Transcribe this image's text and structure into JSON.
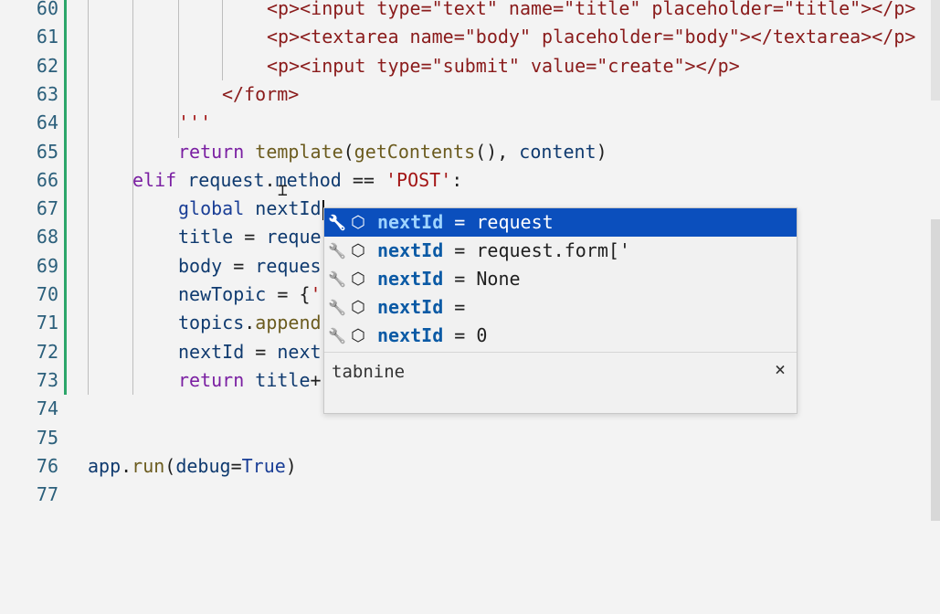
{
  "editor": {
    "lines": [
      {
        "num": "60",
        "parts": [
          [
            "tag",
            "<p><input type=\"text\" name=\"title\" placeholder=\"title\"></p>"
          ]
        ],
        "indent": 292
      },
      {
        "num": "61",
        "parts": [
          [
            "tag",
            "<p><textarea name=\"body\" placeholder=\"body\"></textarea></p>"
          ]
        ],
        "indent": 292
      },
      {
        "num": "62",
        "parts": [
          [
            "tag",
            "<p><input type=\"submit\" value=\"create\"></p>"
          ]
        ],
        "indent": 292
      },
      {
        "num": "63",
        "parts": [
          [
            "tag",
            "</form>"
          ]
        ],
        "indent": 243
      },
      {
        "num": "64",
        "parts": [
          [
            "str",
            "'''"
          ]
        ],
        "indent": 195
      },
      {
        "num": "65",
        "parts": [
          [
            "kw",
            "return "
          ],
          [
            "fn",
            "template"
          ],
          [
            "plain",
            "("
          ],
          [
            "fn",
            "getContents"
          ],
          [
            "plain",
            "(), "
          ],
          [
            "var",
            "content"
          ],
          [
            "plain",
            ")"
          ]
        ],
        "indent": 195
      },
      {
        "num": "66",
        "parts": [
          [
            "kw",
            "elif "
          ],
          [
            "var",
            "request"
          ],
          [
            "plain",
            "."
          ],
          [
            "var",
            "method"
          ],
          [
            "plain",
            " == "
          ],
          [
            "str",
            "'POST'"
          ],
          [
            "plain",
            ":"
          ]
        ],
        "indent": 145
      },
      {
        "num": "67",
        "parts": [
          [
            "blu",
            "global "
          ],
          [
            "var",
            "nextId"
          ]
        ],
        "indent": 195,
        "caret": true
      },
      {
        "num": "68",
        "parts": [
          [
            "var",
            "title"
          ],
          [
            "plain",
            " = "
          ],
          [
            "var",
            "reque"
          ]
        ],
        "indent": 195
      },
      {
        "num": "69",
        "parts": [
          [
            "var",
            "body"
          ],
          [
            "plain",
            " = "
          ],
          [
            "var",
            "reques"
          ]
        ],
        "indent": 195
      },
      {
        "num": "70",
        "parts": [
          [
            "var",
            "newTopic"
          ],
          [
            "plain",
            " = {"
          ],
          [
            "str",
            "'"
          ]
        ],
        "indent": 195
      },
      {
        "num": "71",
        "parts": [
          [
            "var",
            "topics"
          ],
          [
            "plain",
            "."
          ],
          [
            "fn",
            "append"
          ]
        ],
        "indent": 195
      },
      {
        "num": "72",
        "parts": [
          [
            "var",
            "nextId"
          ],
          [
            "plain",
            " = "
          ],
          [
            "var",
            "next"
          ]
        ],
        "indent": 195
      },
      {
        "num": "73",
        "parts": [
          [
            "kw",
            "return "
          ],
          [
            "var",
            "title"
          ],
          [
            "plain",
            "+"
          ]
        ],
        "indent": 195
      },
      {
        "num": "74",
        "parts": [],
        "indent": 96
      },
      {
        "num": "75",
        "parts": [],
        "indent": 96
      },
      {
        "num": "76",
        "parts": [
          [
            "var",
            "app"
          ],
          [
            "plain",
            "."
          ],
          [
            "fn",
            "run"
          ],
          [
            "plain",
            "("
          ],
          [
            "var",
            "debug"
          ],
          [
            "plain",
            "="
          ],
          [
            "blu",
            "True"
          ],
          [
            "plain",
            ")"
          ]
        ],
        "indent": 96
      },
      {
        "num": "77",
        "parts": [],
        "indent": 96
      }
    ]
  },
  "suggest": {
    "items": [
      {
        "match": "nextId",
        "rest": " = request",
        "selected": true
      },
      {
        "match": "nextId",
        "rest": " = request.form['",
        "selected": false
      },
      {
        "match": "nextId",
        "rest": " = None",
        "selected": false
      },
      {
        "match": "nextId",
        "rest": " =",
        "selected": false
      },
      {
        "match": "nextId",
        "rest": " = 0",
        "selected": false
      }
    ],
    "icon1": "wrench-icon",
    "icon2": "cube-icon",
    "source": "tabnine",
    "close": "×"
  },
  "colors": {
    "selection": "#0b4fbd",
    "gutter_modified": "#2ca66a"
  }
}
